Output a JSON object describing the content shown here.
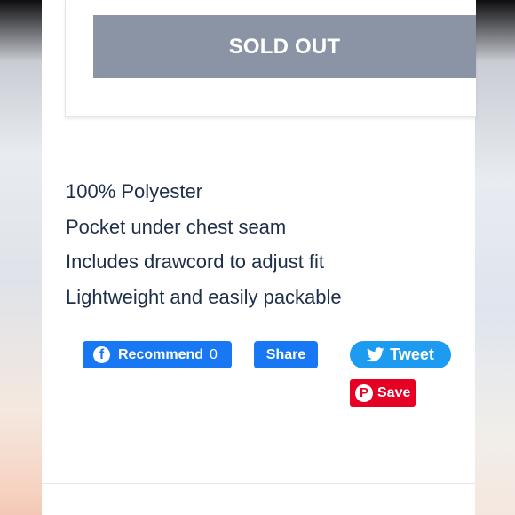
{
  "product": {
    "sold_out_label": "SOLD OUT",
    "features": [
      "100% Polyester",
      "Pocket under chest seam",
      "Includes drawcord to adjust fit",
      "Lightweight and easily packable"
    ]
  },
  "social": {
    "facebook_recommend_label": "Recommend",
    "facebook_recommend_count": "0",
    "facebook_share_label": "Share",
    "tweet_label": "Tweet",
    "pinterest_save_label": "Save",
    "facebook_color": "#1877f2",
    "twitter_color": "#1d9bf0",
    "pinterest_color": "#e60023",
    "icons": {
      "facebook": "facebook-icon",
      "twitter": "twitter-bird-icon",
      "pinterest": "pinterest-icon"
    }
  },
  "colors": {
    "sold_out_bg": "#8a94a4",
    "text": "#1f2f4a"
  }
}
